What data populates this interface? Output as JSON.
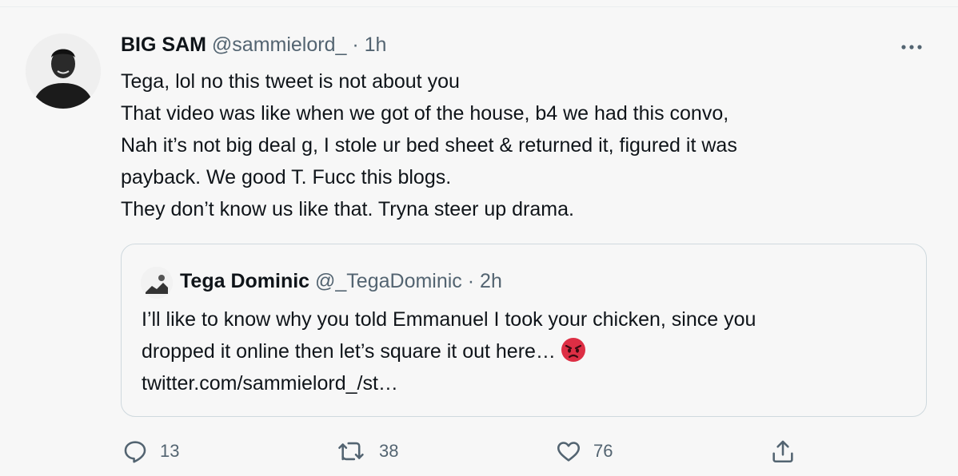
{
  "tweet": {
    "author_name": "BIG SAM",
    "author_handle": "@sammielord_",
    "separator": "·",
    "time": "1h",
    "text_lines": [
      "Tega, lol no this tweet is not about you",
      "That video was like when we got of the house, b4 we had this convo,",
      "Nah it’s not big deal g, I stole ur bed sheet & returned it, figured it was",
      "payback. We good T. Fucc this blogs.",
      "They don’t know us like that. Tryna steer up drama."
    ]
  },
  "quote": {
    "author_name": "Tega Dominic",
    "author_handle": "@_TegaDominic",
    "separator": "·",
    "time": "2h",
    "text_lines": [
      "I’ll like to know why you told Emmanuel I took your chicken, since you",
      "dropped it online then let’s square it out here…",
      "twitter.com/sammielord_/st…"
    ],
    "emoji": "angry-face"
  },
  "actions": {
    "reply_count": "13",
    "retweet_count": "38",
    "like_count": "76"
  },
  "colors": {
    "text": "#0f1419",
    "secondary": "#536471",
    "border": "#cfd9de",
    "background": "#f7f7f7"
  },
  "icons": [
    "more-icon",
    "reply-icon",
    "retweet-icon",
    "like-icon",
    "share-icon"
  ]
}
